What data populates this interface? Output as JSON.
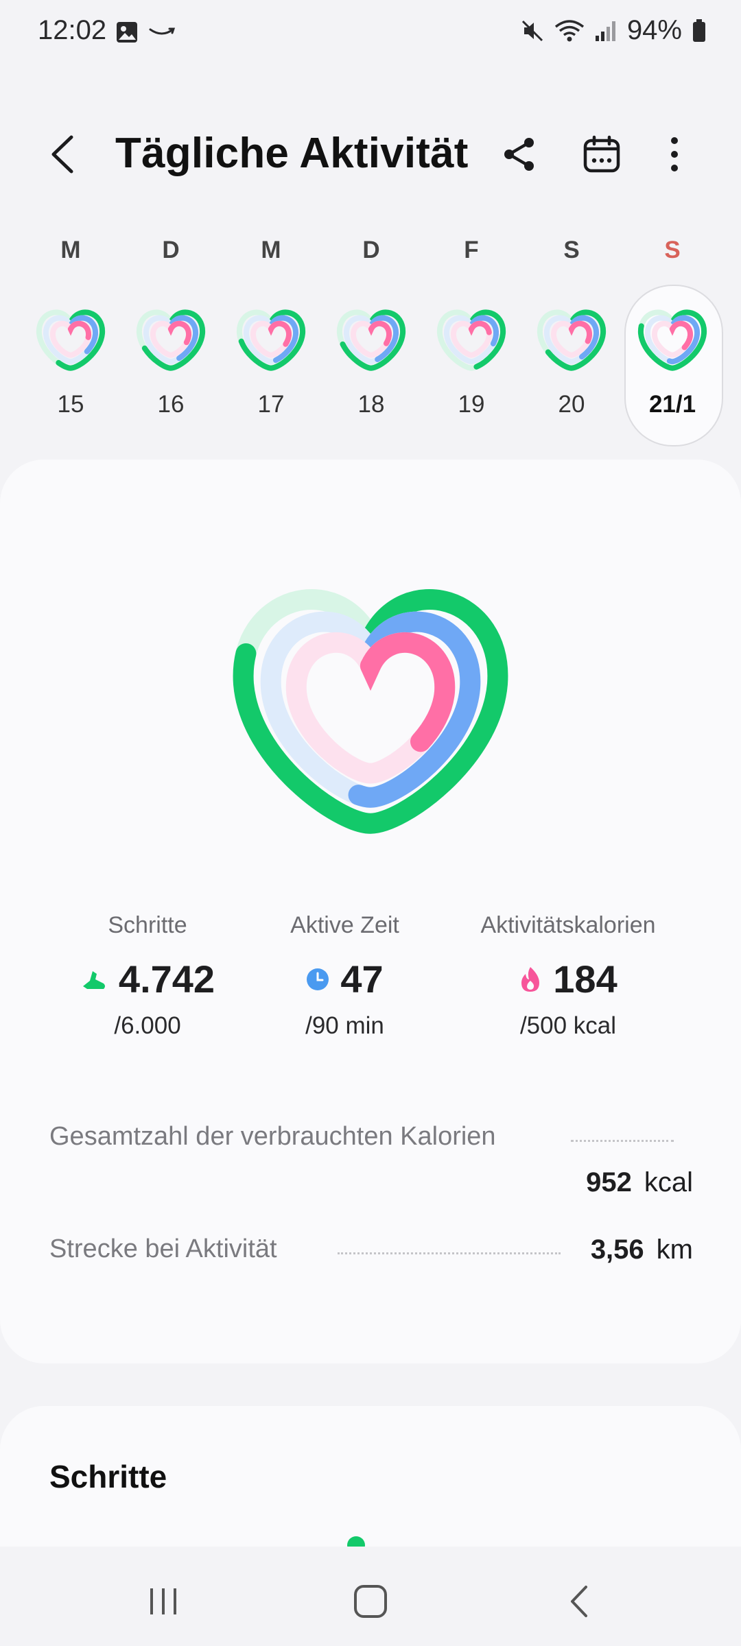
{
  "status_bar": {
    "time": "12:02",
    "battery": "94%"
  },
  "header": {
    "title": "Tägliche Aktivität"
  },
  "week": {
    "days": [
      {
        "letter": "M",
        "date": "15"
      },
      {
        "letter": "D",
        "date": "16"
      },
      {
        "letter": "M",
        "date": "17"
      },
      {
        "letter": "D",
        "date": "18"
      },
      {
        "letter": "F",
        "date": "19"
      },
      {
        "letter": "S",
        "date": "20"
      },
      {
        "letter": "S",
        "date": "21/1"
      }
    ]
  },
  "activity": {
    "steps": {
      "label": "Schritte",
      "value": "4.742",
      "goal": "/6.000",
      "progress": 0.79
    },
    "active_time": {
      "label": "Aktive Zeit",
      "value": "47",
      "goal": "/90 min",
      "progress": 0.52
    },
    "calories": {
      "label": "Aktivitätskalorien",
      "value": "184",
      "goal": "/500 kcal",
      "progress": 0.37
    }
  },
  "details": {
    "total_calories": {
      "label": "Gesamtzahl der verbrauchten Kalorien",
      "value": "952",
      "unit": "kcal"
    },
    "distance": {
      "label": "Strecke bei Aktivität",
      "value": "3,56",
      "unit": "km"
    }
  },
  "steps_card": {
    "title": "Schritte"
  },
  "colors": {
    "steps": "#13c96a",
    "active_time": "#6fa8f5",
    "calories": "#ff6fa6",
    "sunday": "#d8625a"
  },
  "icons": {
    "back": "chevron-left-icon",
    "share": "share-icon",
    "calendar": "calendar-icon",
    "more": "more-vertical-icon"
  }
}
